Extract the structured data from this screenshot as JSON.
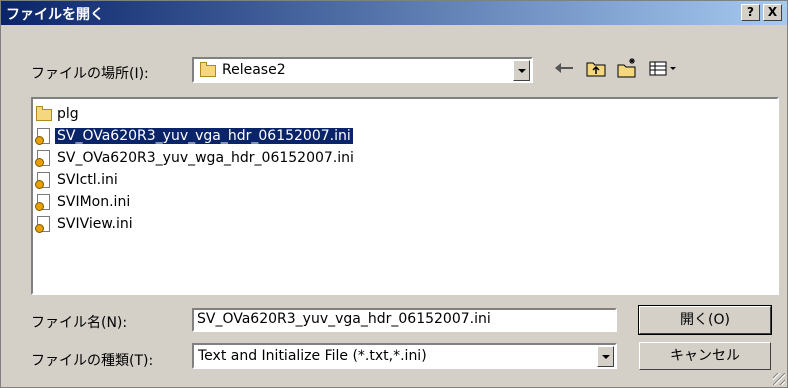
{
  "window": {
    "title": "ファイルを開く",
    "help_label": "?",
    "close_label": "X"
  },
  "look_in": {
    "label": "ファイルの場所(I):",
    "value": "Release2"
  },
  "toolbar": {
    "back_icon": "back-arrow-icon",
    "up_icon": "up-folder-icon",
    "new_folder_icon": "new-folder-icon",
    "view_icon": "view-menu-icon"
  },
  "files": {
    "items": [
      {
        "name": "plg",
        "type": "folder"
      },
      {
        "name": "SV_OVa620R3_yuv_vga_hdr_06152007.ini",
        "type": "ini",
        "selected": true
      },
      {
        "name": "SV_OVa620R3_yuv_wga_hdr_06152007.ini",
        "type": "ini"
      },
      {
        "name": "SVIctl.ini",
        "type": "ini"
      },
      {
        "name": "SVIMon.ini",
        "type": "ini"
      },
      {
        "name": "SVIView.ini",
        "type": "ini"
      }
    ]
  },
  "filename": {
    "label": "ファイル名(N):",
    "value": "SV_OVa620R3_yuv_vga_hdr_06152007.ini"
  },
  "filetype": {
    "label": "ファイルの種類(T):",
    "value": "Text and Initialize File (*.txt,*.ini)"
  },
  "buttons": {
    "open": "開く(O)",
    "cancel": "キャンセル"
  },
  "colors": {
    "title_bar": "#0a246a",
    "selection": "#0a246a",
    "face": "#d4d0c8"
  }
}
